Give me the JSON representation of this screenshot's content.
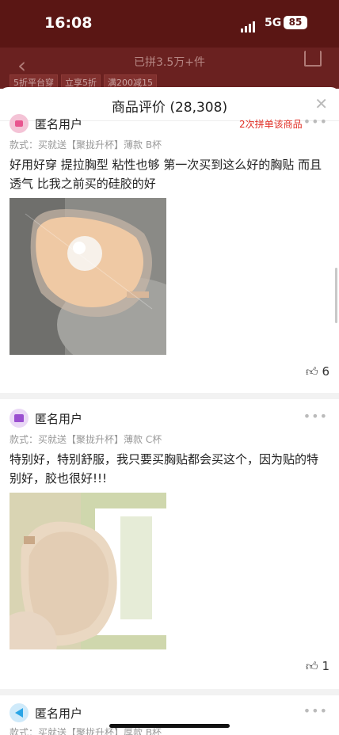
{
  "status_bar": {
    "time": "16:08",
    "network": "5G",
    "battery": "85"
  },
  "app_bar": {
    "title": "已拼3.5万+件",
    "tags": [
      "5折平台穿",
      "立享5折",
      "满200减15"
    ]
  },
  "sheet": {
    "title": "商品评价 (28,308)"
  },
  "reviews": [
    {
      "user": "匿名用户",
      "badge": "2次拼单该商品",
      "variant": "款式：买就送【聚拢升杯】薄款 B杯",
      "text": "好用好穿  提拉胸型  粘性也够  第一次买到这么好的胸贴  而且透气  比我之前买的硅胶的好",
      "likes": "6",
      "avatar_color": "#e8558f"
    },
    {
      "user": "匿名用户",
      "variant": "款式：买就送【聚拢升杯】薄款 C杯",
      "text": "特别好，特别舒服，我只要买胸贴都会买这个，因为贴的特别好，胶也很好!!!",
      "likes": "1",
      "avatar_color": "#9a4fd0"
    },
    {
      "user": "匿名用户",
      "variant": "款式：买就送【聚拢升杯】厚款 B杯",
      "avatar_color": "#2aa5e6"
    }
  ],
  "icons": {
    "back": "chevron-left-icon",
    "share": "share-icon",
    "close": "close-icon",
    "more": "more-dots-icon",
    "like": "thumbs-up-icon"
  }
}
